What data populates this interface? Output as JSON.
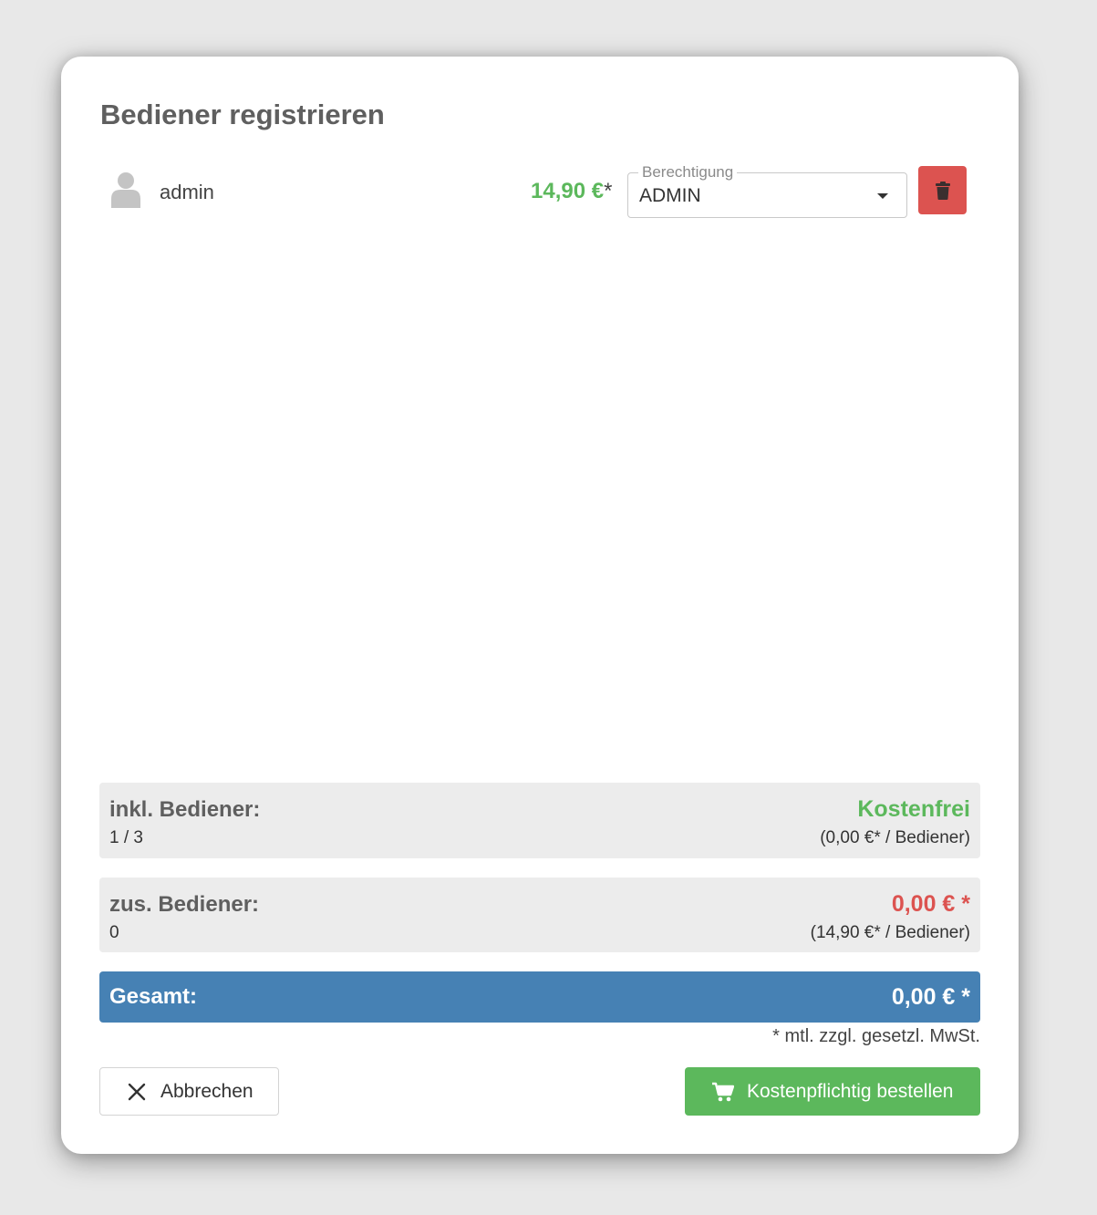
{
  "dialog": {
    "title": "Bediener registrieren"
  },
  "user": {
    "name": "admin",
    "avatar_icon": "user-icon",
    "price": "14,90 €",
    "price_star": "*",
    "permission_label": "Berechtigung",
    "permission_value": "ADMIN",
    "delete_icon": "trash-icon"
  },
  "included": {
    "label": "inkl. Bediener:",
    "count": "1 / 3",
    "value": "Kostenfrei",
    "rate": "(0,00 €* / Bediener)"
  },
  "additional": {
    "label": "zus. Bediener:",
    "count": "0",
    "value": "0,00 € *",
    "rate": "(14,90 €* / Bediener)"
  },
  "total": {
    "label": "Gesamt:",
    "value": "0,00 € *"
  },
  "footnote": "* mtl. zzgl. gesetzl. MwSt.",
  "buttons": {
    "cancel_label": "Abbrechen",
    "cancel_icon": "close-icon",
    "order_label": "Kostenpflichtig bestellen",
    "order_icon": "cart-icon"
  },
  "colors": {
    "green": "#5cb85c",
    "red": "#dc5350",
    "blue": "#4681b4",
    "summary_bg": "#ececec"
  }
}
